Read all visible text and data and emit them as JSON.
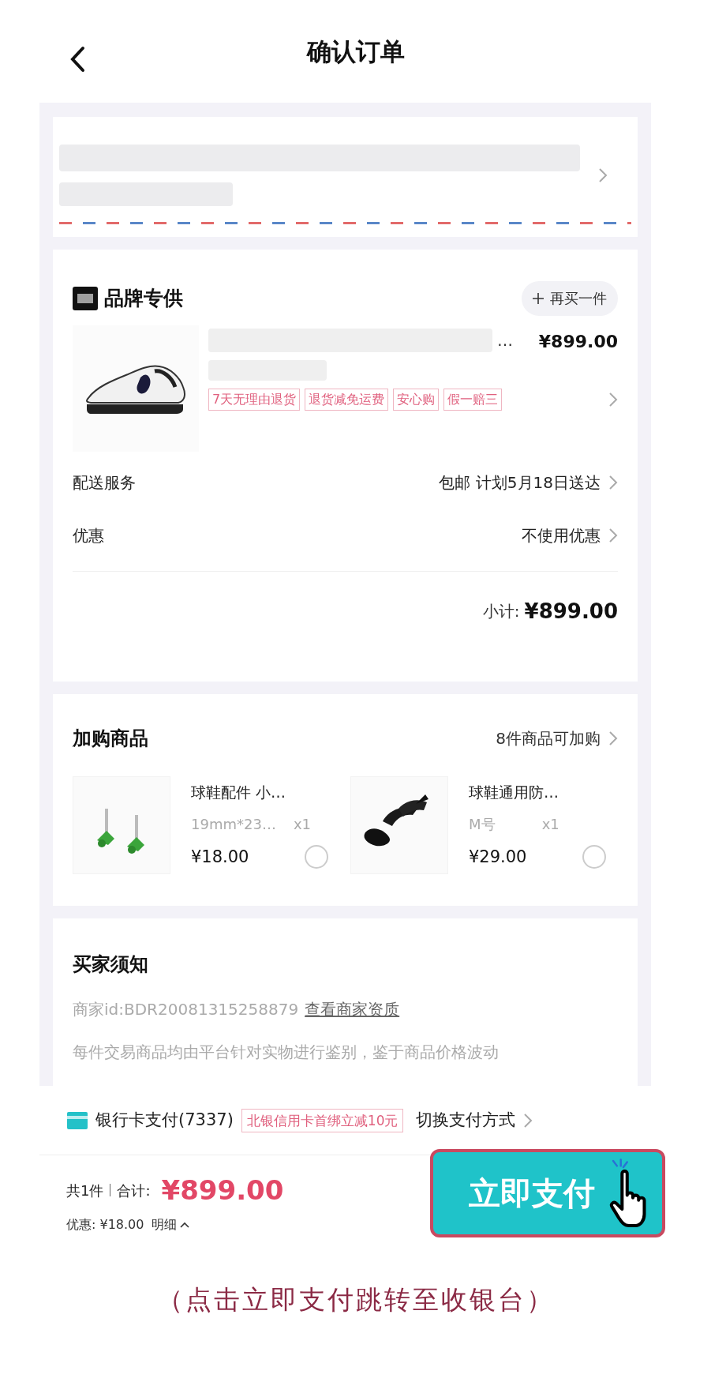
{
  "header": {
    "title": "确认订单"
  },
  "order": {
    "brand": "品牌专供",
    "rebuy": "再买一件",
    "ellipsis": "…",
    "price": "¥899.00",
    "tags": [
      "7天无理由退货",
      "退货减免运费",
      "安心购",
      "假一赔三"
    ],
    "rows": [
      {
        "label": "配送服务",
        "value": "包邮 计划5月18日送达"
      },
      {
        "label": "优惠",
        "value": "不使用优惠"
      }
    ],
    "subtotal_label": "小计:",
    "subtotal": "¥899.00"
  },
  "addons": {
    "title": "加购商品",
    "more": "8件商品可加购",
    "items": [
      {
        "kind": "tags",
        "name": "球鞋配件 小…",
        "spec": "19mm*23…",
        "qty": "x1",
        "price": "¥18.00",
        "selected": false
      },
      {
        "kind": "shields",
        "name": "球鞋通用防…",
        "spec": "M号",
        "qty": "x1",
        "price": "¥29.00",
        "selected": false
      }
    ]
  },
  "notice": {
    "title": "买家须知",
    "merchant": "商家id:BDR20081315258879",
    "link": "查看商家资质",
    "text": "每件交易商品均由平台针对实物进行鉴别，鉴于商品价格波动"
  },
  "payment": {
    "method": "银行卡支付(7337)",
    "promo": "北银信用卡首绑立减10元",
    "switch": "切换支付方式"
  },
  "footer": {
    "count": "共1件",
    "total_label": "合计:",
    "total": "¥899.00",
    "discount": "优惠: ¥18.00",
    "detail": "明细",
    "pay": "立即支付"
  },
  "caption": "（点击立即支付跳转至收银台）"
}
